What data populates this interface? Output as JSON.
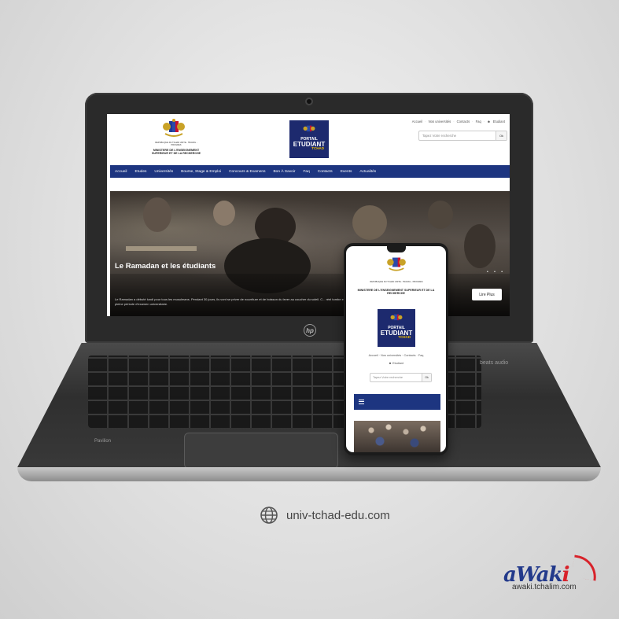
{
  "desktop": {
    "header": {
      "ministry_small": "REPUBLIQUE DU TCHAD UNITE - TRAVAIL - PROGRES",
      "ministry": "MINISTERE DE L'ENSEIGNEMENT SUPERIEUR ET DE LA RECHERCHE",
      "portal": {
        "line1": "PORTAIL",
        "line2": "ETUDIANT",
        "line3": "TCHAD"
      },
      "top_links": [
        "Accueil",
        "Nos universités",
        "Contacts",
        "Faq",
        "Etudiant"
      ],
      "search_placeholder": "Tapez Votre recherche",
      "search_button": "Ok"
    },
    "nav": [
      "Accueil",
      "Etudes",
      "Universités",
      "Bourse, Stage & Emploi",
      "Concours & Examens",
      "Bon À Savoir",
      "Faq",
      "Contacts",
      "Events",
      "Actualités"
    ],
    "hero": {
      "title": "Le Ramadan et les étudiants",
      "text": "Le Ramadan a débuté lundi pour tous les musulmans. Pendant 30 jours, ils vont se priver de nourriture et de boisson du lever au coucher du soleil. C... réel tombe en pleine période d'examen universitaire.",
      "button": "Lire Plus",
      "dots": "• • •"
    }
  },
  "mobile": {
    "ministry_small": "REPUBLIQUE DU TCHAD UNITE - TRAVAIL - PROGRES",
    "ministry": "MINISTERE DE L'ENSEIGNEMENT SUPERIEUR ET DE LA RECHERCHE",
    "portal": {
      "line1": "PORTAIL",
      "line2": "ETUDIANT",
      "line3": "TCHAD"
    },
    "links_line1": "Accueil · Nos universités · Contacts · Faq",
    "links_line2": "Etudiant",
    "search_placeholder": "Tapez Votre recherche",
    "search_button": "Ok"
  },
  "laptop": {
    "brand": "hp",
    "model": "Pavilion",
    "speaker": "beats audio"
  },
  "footer": {
    "url": "univ-tchad-edu.com",
    "awaki_logo_a": "aWak",
    "awaki_logo_i": "i",
    "awaki_url": "awaki.tchalim.com"
  },
  "colors": {
    "nav_blue": "#1d3580",
    "portal_blue": "#1d2a6e",
    "awaki_blue": "#233a8b",
    "awaki_red": "#d8222a"
  }
}
